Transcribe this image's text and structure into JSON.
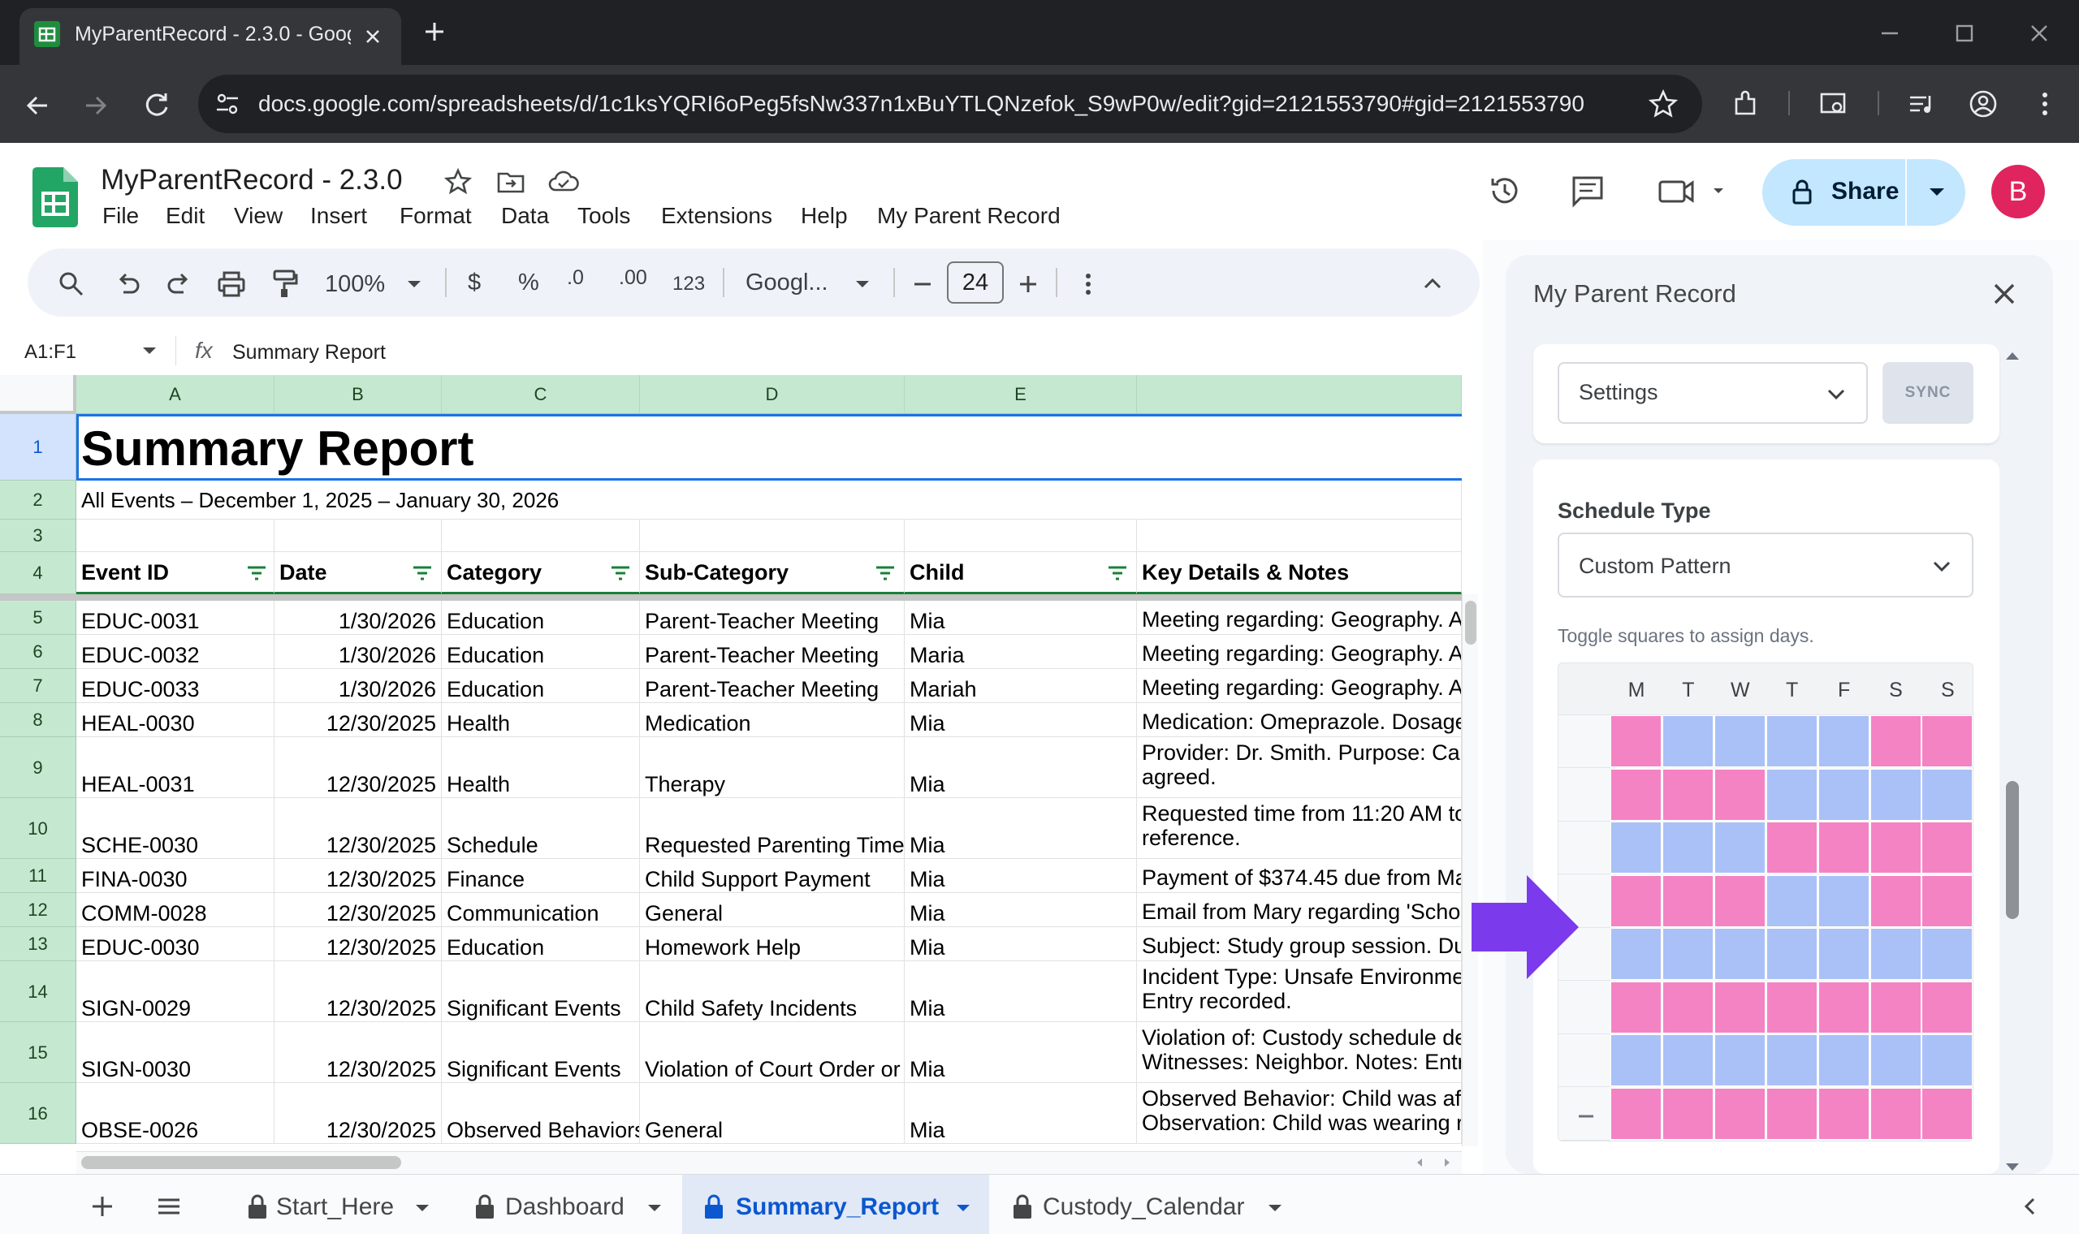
{
  "browser": {
    "tab_title": "MyParentRecord - 2.3.0 - Googl",
    "url": "docs.google.com/spreadsheets/d/1c1ksYQRI6oPeg5fsNw337n1xBuYTLQNzefok_S9wP0w/edit?gid=2121553790#gid=2121553790"
  },
  "doc": {
    "title": "MyParentRecord - 2.3.0",
    "menus": [
      "File",
      "Edit",
      "View",
      "Insert",
      "Format",
      "Data",
      "Tools",
      "Extensions",
      "Help",
      "My Parent Record"
    ],
    "share_label": "Share",
    "avatar_letter": "B"
  },
  "toolbar": {
    "zoom": "100%",
    "currency": "$",
    "percent": "%",
    "dec_less": ".0",
    "dec_more": ".00",
    "number_format": "123",
    "font": "Googl...",
    "font_size": "24"
  },
  "formula_bar": {
    "name_box": "A1:F1",
    "fx": "fx",
    "content": "Summary Report"
  },
  "sheet": {
    "columns": [
      "A",
      "B",
      "C",
      "D",
      "E",
      ""
    ],
    "title": "Summary Report",
    "subtitle": "All Events – December 1, 2025 – January 30, 2026",
    "headers": [
      "Event ID",
      "Date",
      "Category",
      "Sub-Category",
      "Child",
      "Key Details & Notes"
    ],
    "rows": [
      {
        "num": "5",
        "id": "EDUC-0031",
        "date": "1/30/2026",
        "cat": "Education",
        "sub": "Parent-Teacher Meeting",
        "child": "Mia",
        "notes1": "Meeting regarding: Geography. A",
        "notes2": ""
      },
      {
        "num": "6",
        "id": "EDUC-0032",
        "date": "1/30/2026",
        "cat": "Education",
        "sub": "Parent-Teacher Meeting",
        "child": "Maria",
        "notes1": "Meeting regarding: Geography. A",
        "notes2": ""
      },
      {
        "num": "7",
        "id": "EDUC-0033",
        "date": "1/30/2026",
        "cat": "Education",
        "sub": "Parent-Teacher Meeting",
        "child": "Mariah",
        "notes1": "Meeting regarding: Geography. A",
        "notes2": ""
      },
      {
        "num": "8",
        "id": "HEAL-0030",
        "date": "12/30/2025",
        "cat": "Health",
        "sub": "Medication",
        "child": "Mia",
        "notes1": "Medication: Omeprazole. Dosage",
        "notes2": ""
      },
      {
        "num": "9",
        "id": "HEAL-0031",
        "date": "12/30/2025",
        "cat": "Health",
        "sub": "Therapy",
        "child": "Mia",
        "notes1": "Provider: Dr. Smith. Purpose: Ca",
        "notes2": "agreed."
      },
      {
        "num": "10",
        "id": "SCHE-0030",
        "date": "12/30/2025",
        "cat": "Schedule",
        "sub": "Requested Parenting Time",
        "child": "Mia",
        "notes1": "Requested time from 11:20 AM to",
        "notes2": "reference."
      },
      {
        "num": "11",
        "id": "FINA-0030",
        "date": "12/30/2025",
        "cat": "Finance",
        "sub": "Child Support Payment",
        "child": "Mia",
        "notes1": "Payment of $374.45 due from Ma",
        "notes2": ""
      },
      {
        "num": "12",
        "id": "COMM-0028",
        "date": "12/30/2025",
        "cat": "Communication",
        "sub": "General",
        "child": "Mia",
        "notes1": "Email from Mary regarding 'Scho",
        "notes2": ""
      },
      {
        "num": "13",
        "id": "EDUC-0030",
        "date": "12/30/2025",
        "cat": "Education",
        "sub": "Homework Help",
        "child": "Mia",
        "notes1": "Subject: Study group session. Du",
        "notes2": ""
      },
      {
        "num": "14",
        "id": "SIGN-0029",
        "date": "12/30/2025",
        "cat": "Significant Events",
        "sub": "Child Safety Incidents",
        "child": "Mia",
        "notes1": "Incident Type: Unsafe Environme",
        "notes2": "Entry recorded."
      },
      {
        "num": "15",
        "id": "SIGN-0030",
        "date": "12/30/2025",
        "cat": "Significant Events",
        "sub": "Violation of Court Order or",
        "child": "Mia",
        "notes1": "Violation of: Custody schedule de",
        "notes2": "Witnesses: Neighbor. Notes: Entr"
      },
      {
        "num": "16",
        "id": "OBSE-0026",
        "date": "12/30/2025",
        "cat": "Observed Behaviors",
        "sub": "General",
        "child": "Mia",
        "notes1": "Observed Behavior: Child was af",
        "notes2": "Observation: Child was wearing r"
      }
    ]
  },
  "sheet_tabs": [
    "Start_Here",
    "Dashboard",
    "Summary_Report",
    "Custody_Calendar"
  ],
  "panel": {
    "title": "My Parent Record",
    "view_select": "Settings",
    "sync_label": "SYNC",
    "schedule_type_label": "Schedule Type",
    "schedule_type_value": "Custom Pattern",
    "hint": "Toggle squares to assign days.",
    "days": [
      "M",
      "T",
      "W",
      "T",
      "F",
      "S",
      "S"
    ],
    "pattern": [
      "PBBBBPP",
      "PPPBBBB",
      "BBBPPPP",
      "PPPBBPP",
      "BBBBBBB",
      "PPPPPPP",
      "BBBBBBB",
      "PPPPPPP"
    ],
    "pink": "#f483c4",
    "blue": "#a9c1f7",
    "arrow_color": "#7c3aed"
  }
}
